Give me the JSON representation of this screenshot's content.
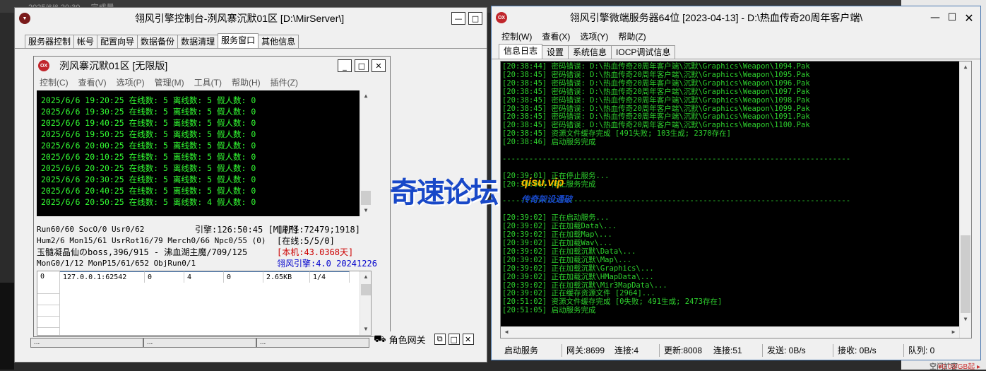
{
  "background": {
    "top_strip_text": "2025/6/6 20:30 ...      完成量...",
    "right_bottom_text": "空间扩容",
    "right_bottom_price": "¥0.03/GB起 ▸"
  },
  "left_window": {
    "title": "翎风引擎控制台-洌风寨沉默01区 [D:\\MirServer\\]",
    "tabs": [
      "服务器控制",
      "帐号",
      "配置向导",
      "数据备份",
      "数据清理",
      "服务窗口",
      "其他信息"
    ],
    "active_tab": "服务窗口",
    "inner": {
      "title": "洌风寨沉默01区 [无限版]",
      "logo": "OX",
      "menu": [
        "控制(C)",
        "查看(V)",
        "选项(P)",
        "管理(M)",
        "工具(T)",
        "帮助(H)",
        "插件(Z)"
      ],
      "log_lines": [
        "2025/6/6 19:20:25 在线数: 5 离线数: 5 假人数: 0",
        "2025/6/6 19:30:25 在线数: 5 离线数: 5 假人数: 0",
        "2025/6/6 19:40:25 在线数: 5 离线数: 5 假人数: 0",
        "2025/6/6 19:50:25 在线数: 5 离线数: 5 假人数: 0",
        "2025/6/6 20:00:25 在线数: 5 离线数: 5 假人数: 0",
        "2025/6/6 20:10:25 在线数: 5 离线数: 5 假人数: 0",
        "2025/6/6 20:20:25 在线数: 5 离线数: 5 假人数: 0",
        "2025/6/6 20:30:25 在线数: 5 离线数: 5 假人数: 0",
        "2025/6/6 20:40:25 在线数: 5 离线数: 5 假人数: 0",
        "2025/6/6 20:50:25 在线数: 5 离线数: 4 假人数: 0"
      ],
      "stats": {
        "row1_left": "Run60/60 SocO/0 Usr0/62",
        "row1_mid": "引擎:126:50:45 [M][F]",
        "row1_right": "[刷怪:72479;1918]",
        "row2_left": "Hum2/6 Mon15/61 UsrRot16/79 Merch0/66 Npc0/55 (0)",
        "row2_right": "[在线:5/5/0]",
        "row3_left": "玉髓凝晶仙のboss,396/915 - 沸血湖主魔/709/125",
        "row3_right": "[本机:43.0368天]",
        "row4_left": "MonG0/1/12 MonP15/61/652 ObjRun0/1",
        "row4_right": "翎风引擎:4.0 20241226"
      },
      "table_row": [
        "0",
        "127.0.0.1:62542",
        "0",
        "4",
        "0",
        "2.65KB",
        "1/4"
      ]
    },
    "bottom_tabs": [
      "角色网关"
    ],
    "bottom_tab_clipped": [
      "...",
      "...",
      "..."
    ]
  },
  "right_window": {
    "title": "翎风引擎微端服务器64位 [2023-04-13] - D:\\热血传奇20周年客户端\\",
    "logo": "OX",
    "menu": [
      "控制(W)",
      "查看(X)",
      "选项(Y)",
      "帮助(Z)"
    ],
    "tabs": [
      "信息日志",
      "设置",
      "系统信息",
      "IOCP调试信息"
    ],
    "active_tab": "信息日志",
    "log_lines": [
      "[20:38:44] 密码错误: D:\\热血传奇20周年客户端\\沉默\\Graphics\\Weapon\\1094.Pak",
      "[20:38:45] 密码错误: D:\\热血传奇20周年客户端\\沉默\\Graphics\\Weapon\\1095.Pak",
      "[20:38:45] 密码错误: D:\\热血传奇20周年客户端\\沉默\\Graphics\\Weapon\\1096.Pak",
      "[20:38:45] 密码错误: D:\\热血传奇20周年客户端\\沉默\\Graphics\\Weapon\\1097.Pak",
      "[20:38:45] 密码错误: D:\\热血传奇20周年客户端\\沉默\\Graphics\\Weapon\\1098.Pak",
      "[20:38:45] 密码错误: D:\\热血传奇20周年客户端\\沉默\\Graphics\\Weapon\\1099.Pak",
      "[20:38:45] 密码错误: D:\\热血传奇20周年客户端\\沉默\\Graphics\\Weapon\\1091.Pak",
      "[20:38:45] 密码错误: D:\\热血传奇20周年客户端\\沉默\\Graphics\\Weapon\\1100.Pak",
      "[20:38:45] 资源文件缓存完成 [491失败; 103生成; 2370存在]",
      "[20:38:46] 启动服务完成",
      "",
      "------------------------------------------------------------------------------",
      "",
      "[20:39:01] 正在停止服务...",
      "[20:39:01] 停止服务完成",
      "",
      "------------------------------------------------------------------------------",
      "",
      "[20:39:02] 正在启动服务...",
      "[20:39:02] 正在加载Data\\...",
      "[20:39:02] 正在加载Map\\...",
      "[20:39:02] 正在加载Wav\\...",
      "[20:39:02] 正在加载沉默\\Data\\...",
      "[20:39:02] 正在加载沉默\\Map\\...",
      "[20:39:02] 正在加载沉默\\Graphics\\...",
      "[20:39:02] 正在加载沉默\\HMapData\\...",
      "[20:39:02] 正在加载沉默\\Mir3MapData\\...",
      "[20:39:02] 正在缓存资源文件 [2964]...",
      "[20:51:02] 资源文件缓存完成 [0失败; 491生成; 2473存在]",
      "[20:51:05] 启动服务完成"
    ],
    "status": {
      "state": "启动服务",
      "gateway": "网关:8699",
      "gateway_conn": "连接:4",
      "update": "更新:8008",
      "update_conn": "连接:51",
      "send": "发送: 0B/s",
      "recv": "接收: 0B/s",
      "queue": "队列: 0"
    }
  },
  "watermark": {
    "main": "奇速论坛",
    "url": "qisu.vip",
    "sub": "传奇架设通破"
  },
  "colors": {
    "console_text": "#33ff33",
    "console_bg": "#000000",
    "stat_red": "#cc0000",
    "stat_blue": "#0000cc",
    "watermark_blue": "#1848c8",
    "watermark_yellow": "#f5b800"
  }
}
